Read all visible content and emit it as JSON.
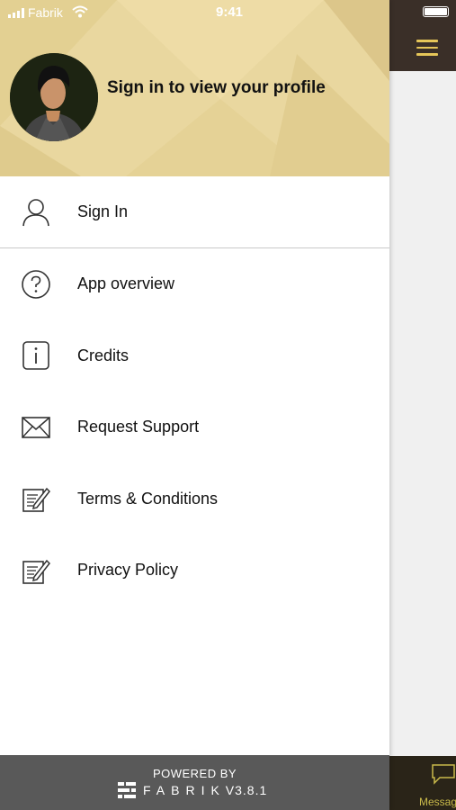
{
  "status_bar": {
    "carrier": "Fabrik",
    "time": "9:41"
  },
  "profile": {
    "prompt": "Sign in to view your profile"
  },
  "menu": {
    "items": [
      {
        "label": "Sign In",
        "icon": "user-icon"
      },
      {
        "label": "App overview",
        "icon": "question-circle-icon"
      },
      {
        "label": "Credits",
        "icon": "info-icon"
      },
      {
        "label": "Request Support",
        "icon": "envelope-icon"
      },
      {
        "label": "Terms & Conditions",
        "icon": "document-edit-icon"
      },
      {
        "label": "Privacy Policy",
        "icon": "document-edit-icon"
      }
    ]
  },
  "footer": {
    "powered_by": "POWERED BY",
    "brand": "FABRIK",
    "version": "V3.8.1"
  },
  "background_app": {
    "tab_label": "Messag"
  },
  "colors": {
    "header_bg": "#e9d79f",
    "topbar_bg": "#3a2f28",
    "menu_accent": "#e6c659",
    "footer_bg": "#595959"
  }
}
